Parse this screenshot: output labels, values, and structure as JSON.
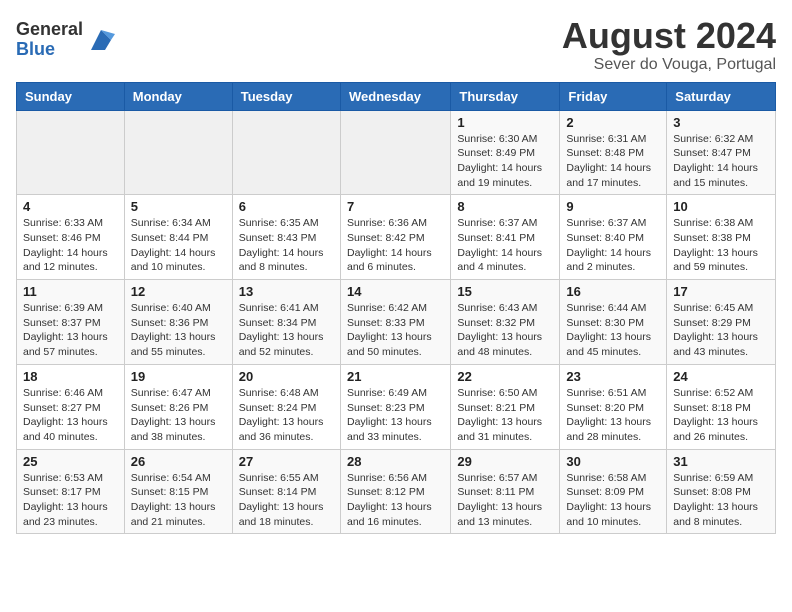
{
  "logo": {
    "general": "General",
    "blue": "Blue"
  },
  "title": "August 2024",
  "subtitle": "Sever do Vouga, Portugal",
  "days_of_week": [
    "Sunday",
    "Monday",
    "Tuesday",
    "Wednesday",
    "Thursday",
    "Friday",
    "Saturday"
  ],
  "weeks": [
    [
      {
        "day": "",
        "info": ""
      },
      {
        "day": "",
        "info": ""
      },
      {
        "day": "",
        "info": ""
      },
      {
        "day": "",
        "info": ""
      },
      {
        "day": "1",
        "info": "Sunrise: 6:30 AM\nSunset: 8:49 PM\nDaylight: 14 hours and 19 minutes."
      },
      {
        "day": "2",
        "info": "Sunrise: 6:31 AM\nSunset: 8:48 PM\nDaylight: 14 hours and 17 minutes."
      },
      {
        "day": "3",
        "info": "Sunrise: 6:32 AM\nSunset: 8:47 PM\nDaylight: 14 hours and 15 minutes."
      }
    ],
    [
      {
        "day": "4",
        "info": "Sunrise: 6:33 AM\nSunset: 8:46 PM\nDaylight: 14 hours and 12 minutes."
      },
      {
        "day": "5",
        "info": "Sunrise: 6:34 AM\nSunset: 8:44 PM\nDaylight: 14 hours and 10 minutes."
      },
      {
        "day": "6",
        "info": "Sunrise: 6:35 AM\nSunset: 8:43 PM\nDaylight: 14 hours and 8 minutes."
      },
      {
        "day": "7",
        "info": "Sunrise: 6:36 AM\nSunset: 8:42 PM\nDaylight: 14 hours and 6 minutes."
      },
      {
        "day": "8",
        "info": "Sunrise: 6:37 AM\nSunset: 8:41 PM\nDaylight: 14 hours and 4 minutes."
      },
      {
        "day": "9",
        "info": "Sunrise: 6:37 AM\nSunset: 8:40 PM\nDaylight: 14 hours and 2 minutes."
      },
      {
        "day": "10",
        "info": "Sunrise: 6:38 AM\nSunset: 8:38 PM\nDaylight: 13 hours and 59 minutes."
      }
    ],
    [
      {
        "day": "11",
        "info": "Sunrise: 6:39 AM\nSunset: 8:37 PM\nDaylight: 13 hours and 57 minutes."
      },
      {
        "day": "12",
        "info": "Sunrise: 6:40 AM\nSunset: 8:36 PM\nDaylight: 13 hours and 55 minutes."
      },
      {
        "day": "13",
        "info": "Sunrise: 6:41 AM\nSunset: 8:34 PM\nDaylight: 13 hours and 52 minutes."
      },
      {
        "day": "14",
        "info": "Sunrise: 6:42 AM\nSunset: 8:33 PM\nDaylight: 13 hours and 50 minutes."
      },
      {
        "day": "15",
        "info": "Sunrise: 6:43 AM\nSunset: 8:32 PM\nDaylight: 13 hours and 48 minutes."
      },
      {
        "day": "16",
        "info": "Sunrise: 6:44 AM\nSunset: 8:30 PM\nDaylight: 13 hours and 45 minutes."
      },
      {
        "day": "17",
        "info": "Sunrise: 6:45 AM\nSunset: 8:29 PM\nDaylight: 13 hours and 43 minutes."
      }
    ],
    [
      {
        "day": "18",
        "info": "Sunrise: 6:46 AM\nSunset: 8:27 PM\nDaylight: 13 hours and 40 minutes."
      },
      {
        "day": "19",
        "info": "Sunrise: 6:47 AM\nSunset: 8:26 PM\nDaylight: 13 hours and 38 minutes."
      },
      {
        "day": "20",
        "info": "Sunrise: 6:48 AM\nSunset: 8:24 PM\nDaylight: 13 hours and 36 minutes."
      },
      {
        "day": "21",
        "info": "Sunrise: 6:49 AM\nSunset: 8:23 PM\nDaylight: 13 hours and 33 minutes."
      },
      {
        "day": "22",
        "info": "Sunrise: 6:50 AM\nSunset: 8:21 PM\nDaylight: 13 hours and 31 minutes."
      },
      {
        "day": "23",
        "info": "Sunrise: 6:51 AM\nSunset: 8:20 PM\nDaylight: 13 hours and 28 minutes."
      },
      {
        "day": "24",
        "info": "Sunrise: 6:52 AM\nSunset: 8:18 PM\nDaylight: 13 hours and 26 minutes."
      }
    ],
    [
      {
        "day": "25",
        "info": "Sunrise: 6:53 AM\nSunset: 8:17 PM\nDaylight: 13 hours and 23 minutes."
      },
      {
        "day": "26",
        "info": "Sunrise: 6:54 AM\nSunset: 8:15 PM\nDaylight: 13 hours and 21 minutes."
      },
      {
        "day": "27",
        "info": "Sunrise: 6:55 AM\nSunset: 8:14 PM\nDaylight: 13 hours and 18 minutes."
      },
      {
        "day": "28",
        "info": "Sunrise: 6:56 AM\nSunset: 8:12 PM\nDaylight: 13 hours and 16 minutes."
      },
      {
        "day": "29",
        "info": "Sunrise: 6:57 AM\nSunset: 8:11 PM\nDaylight: 13 hours and 13 minutes."
      },
      {
        "day": "30",
        "info": "Sunrise: 6:58 AM\nSunset: 8:09 PM\nDaylight: 13 hours and 10 minutes."
      },
      {
        "day": "31",
        "info": "Sunrise: 6:59 AM\nSunset: 8:08 PM\nDaylight: 13 hours and 8 minutes."
      }
    ]
  ]
}
